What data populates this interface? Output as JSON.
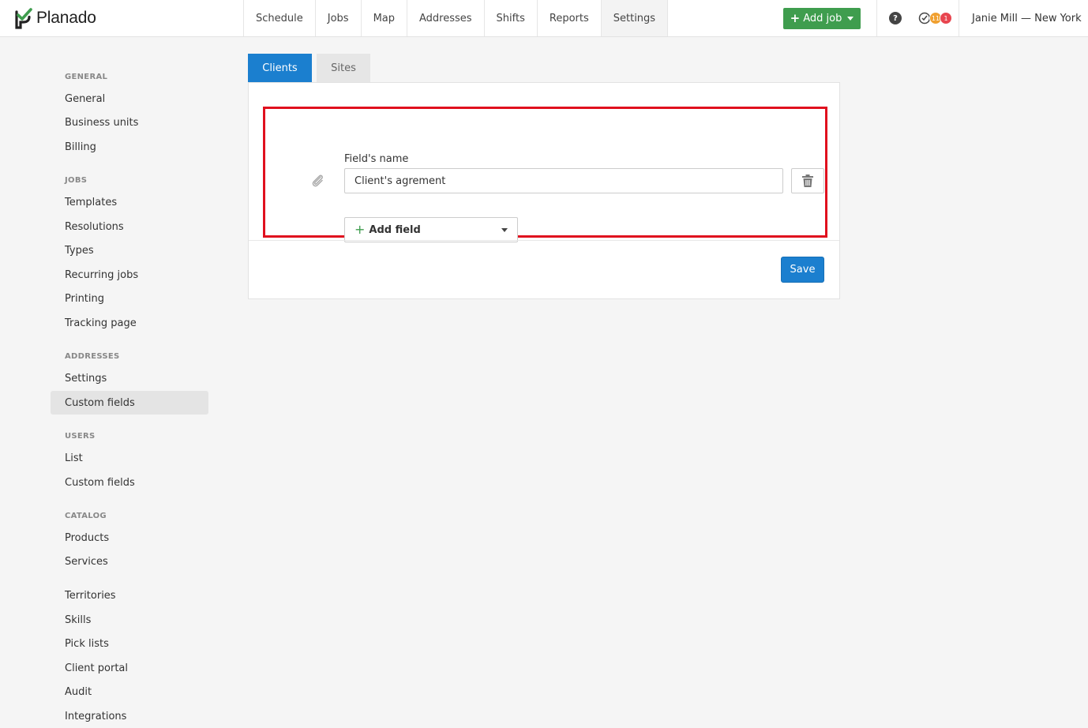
{
  "app": {
    "brand": "Planado",
    "brand_color": "#3f9d4e"
  },
  "topnav": {
    "items": [
      {
        "label": "Schedule"
      },
      {
        "label": "Jobs"
      },
      {
        "label": "Map"
      },
      {
        "label": "Addresses"
      },
      {
        "label": "Shifts"
      },
      {
        "label": "Reports"
      },
      {
        "label": "Settings",
        "active": true
      }
    ],
    "add_job_label": "Add job",
    "help_icon": "question-circle-icon",
    "help_label": "?",
    "status_badges": [
      "11",
      "1"
    ],
    "user_label": "Janie Mill — New York"
  },
  "sidebar": {
    "sections": [
      {
        "title": "GENERAL",
        "items": [
          "General",
          "Business units",
          "Billing"
        ]
      },
      {
        "title": "JOBS",
        "items": [
          "Templates",
          "Resolutions",
          "Types",
          "Recurring jobs",
          "Printing",
          "Tracking page"
        ]
      },
      {
        "title": "ADDRESSES",
        "items": [
          "Settings",
          "Custom fields"
        ]
      },
      {
        "title": "USERS",
        "items": [
          "List",
          "Custom fields"
        ]
      },
      {
        "title": "CATALOG",
        "items": [
          "Products",
          "Services"
        ]
      },
      {
        "title": "",
        "items": [
          "Territories",
          "Skills",
          "Pick lists",
          "Client portal",
          "Audit",
          "Integrations"
        ]
      }
    ],
    "active_item": "addresses-custom-fields"
  },
  "tabs": [
    {
      "label": "Clients",
      "active": true
    },
    {
      "label": "Sites",
      "active": false
    }
  ],
  "form": {
    "field_icon": "paperclip-icon",
    "field_name_label": "Field's name",
    "field_name_value": "Client's agrement",
    "delete_icon": "trash-icon",
    "add_field_label": "Add field",
    "save_label": "Save"
  },
  "colors": {
    "primary": "#1b7fcf",
    "highlight": "#e0101e",
    "badge_orange": "#f0a030",
    "badge_red": "#e8454f"
  }
}
